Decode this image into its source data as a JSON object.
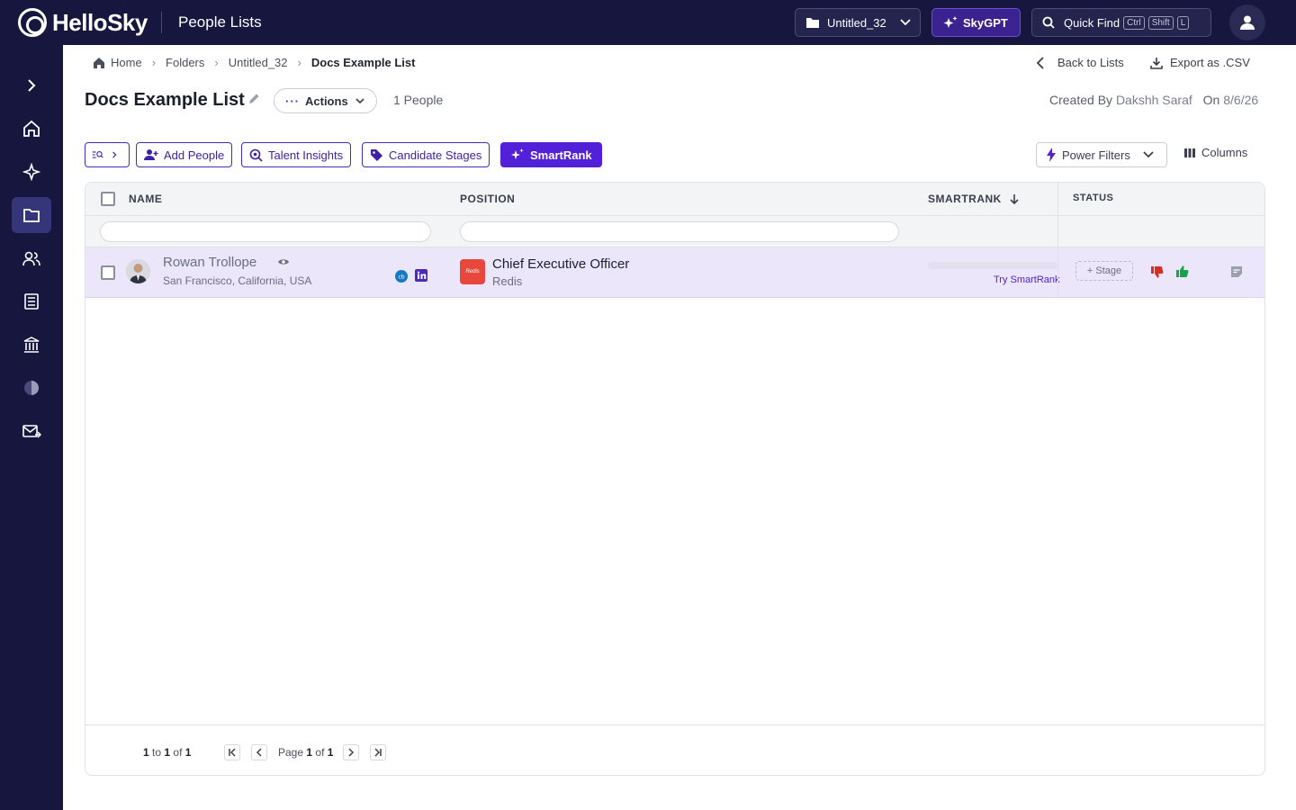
{
  "app": {
    "logo": "HelloSky",
    "section_title": "People Lists"
  },
  "topbar": {
    "folder_select": "Untitled_32",
    "skygpt_label": "SkyGPT",
    "quickfind_label": "Quick Find",
    "shortcut": [
      "Ctrl",
      "Shift",
      "L"
    ]
  },
  "sidebar": {
    "items": [
      "expand-icon",
      "home-icon",
      "sparkle-icon",
      "folder-icon",
      "people-icon",
      "document-icon",
      "bank-icon",
      "chart-pie-icon",
      "mail-icon"
    ],
    "active_index": 3
  },
  "breadcrumb": {
    "items": [
      "Home",
      "Folders",
      "Untitled_32",
      "Docs Example List"
    ]
  },
  "header_links": {
    "back": "Back to Lists",
    "export": "Export as .CSV"
  },
  "list": {
    "title": "Docs Example List",
    "actions_label": "Actions",
    "people_count": "1 People",
    "created_by_label": "Created By",
    "created_by": "Dakshh Saraf",
    "created_on_label": "On",
    "created_on": "8/6/26"
  },
  "toolbar": {
    "add_people": "Add People",
    "talent_insights": "Talent Insights",
    "candidate_stages": "Candidate Stages",
    "smartrank": "SmartRank",
    "power_filters": "Power Filters",
    "columns": "Columns"
  },
  "table": {
    "headers": {
      "name": "NAME",
      "position": "POSITION",
      "smartrank": "SMARTRANK",
      "status": "STATUS"
    },
    "rows": [
      {
        "name": "Rowan Trollope",
        "location": "San Francisco, California, USA",
        "position": "Chief Executive Officer",
        "company": "Redis",
        "company_logo_text": "Redis",
        "smartrank_cta": "Try SmartRank",
        "stage_label": "+ Stage"
      }
    ]
  },
  "pager": {
    "from": "1",
    "to_word": "to",
    "to": "1",
    "of_word": "of",
    "total": "1",
    "page_word": "Page",
    "page": "1",
    "pages": "1"
  },
  "colors": {
    "brand_dark": "#16163f",
    "accent": "#5220d8",
    "row_highlight": "#ece6fb",
    "dislike": "#d92d20",
    "like": "#16a34a"
  }
}
